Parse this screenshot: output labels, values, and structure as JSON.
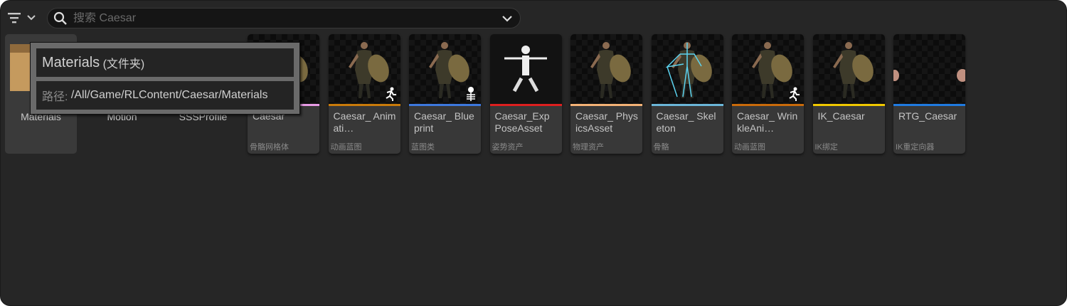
{
  "toolbar": {
    "filter_icon": "filter-icon",
    "search_placeholder": "搜索 Caesar",
    "search_value": ""
  },
  "folders": [
    {
      "name": "Materials",
      "selected": true
    },
    {
      "name": "Motion",
      "selected": false
    },
    {
      "name": "SSSProfile",
      "selected": false
    }
  ],
  "assets": [
    {
      "name": "Caesar",
      "type": "骨骼网格体",
      "color": "#e79be5",
      "thumb": "character"
    },
    {
      "name": "Caesar_ Animati…",
      "type": "动画蓝图",
      "color": "#c97a0a",
      "thumb": "character",
      "badge": "running-man-icon"
    },
    {
      "name": "Caesar_ Blueprint",
      "type": "蓝图类",
      "color": "#3d78de",
      "thumb": "character",
      "badge": "skeleton-icon"
    },
    {
      "name": "Caesar_Exp PoseAsset",
      "type": "姿势资产",
      "color": "#dd1f1f",
      "thumb": "skeleton"
    },
    {
      "name": "Caesar_ PhysicsAsset",
      "type": "物理资产",
      "color": "#f3b276",
      "thumb": "character"
    },
    {
      "name": "Caesar_ Skeleton",
      "type": "骨骼",
      "color": "#6bb6d8",
      "thumb": "character-bones"
    },
    {
      "name": "Caesar_ WrinkleAni…",
      "type": "动画蓝图",
      "color": "#c96a0a",
      "thumb": "character",
      "badge": "running-man-icon"
    },
    {
      "name": "IK_Caesar",
      "type": "IK绑定",
      "color": "#f0c800",
      "thumb": "character"
    },
    {
      "name": "RTG_Caesar",
      "type": "IK重定向器",
      "color": "#1f7ae0",
      "thumb": "feet"
    }
  ],
  "tooltip": {
    "title": "Materials",
    "subtitle": "(文件夹)",
    "path_label": "路径:",
    "path": "/All/Game/RLContent/Caesar/Materials"
  }
}
